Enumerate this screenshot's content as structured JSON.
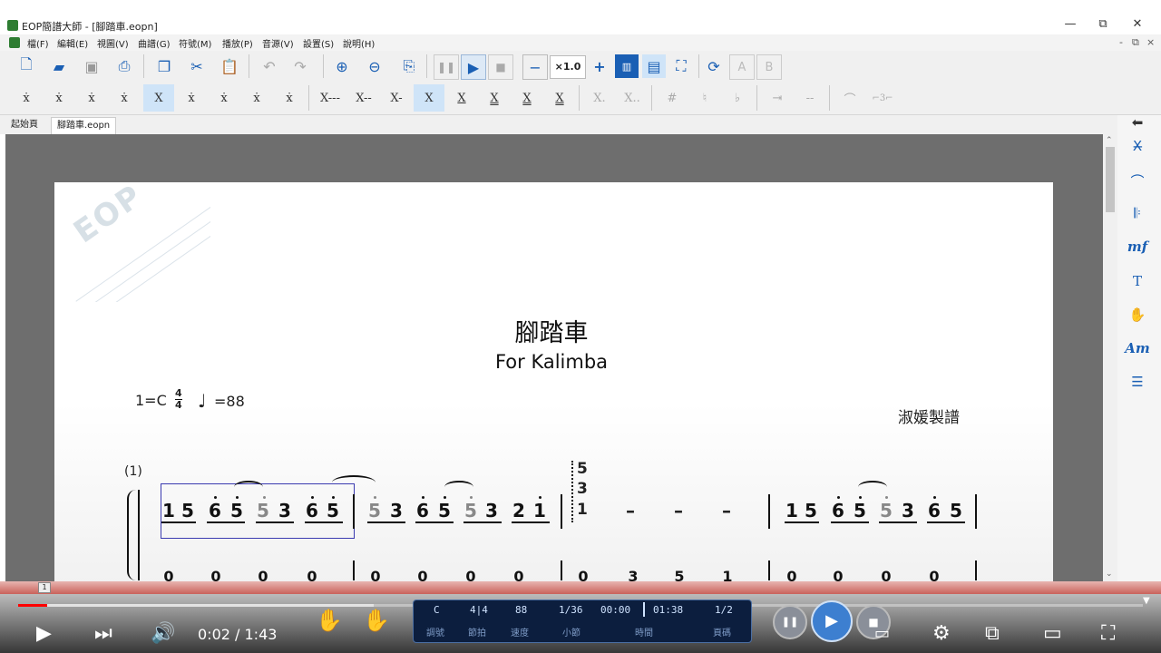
{
  "window": {
    "title": "EOP簡譜大師 - [腳踏車.eopn]",
    "controls": [
      "—",
      "⧉",
      "✕"
    ]
  },
  "menubar": {
    "items": [
      "檔(F)",
      "編輯(E)",
      "視圖(V)",
      "曲譜(G)",
      "符號(M)",
      "播放(P)",
      "音源(V)",
      "設置(S)",
      "說明(H)"
    ],
    "mdi_controls": [
      "-",
      "⧉",
      "×"
    ]
  },
  "toolbar": {
    "speed": "×1.0",
    "playback_icons": [
      "pause-icon",
      "play-icon",
      "stop-icon"
    ],
    "letters": [
      "A",
      "B"
    ]
  },
  "note_toolbar": {
    "duration_labels": [
      "X---",
      "X--",
      "X-",
      "X",
      "X",
      "X",
      "X",
      "X",
      "X.",
      "X.."
    ],
    "accidentals": [
      "#",
      "♮",
      "♭"
    ]
  },
  "tabs": [
    {
      "label": "起始頁",
      "active": false
    },
    {
      "label": "腳踏車.eopn",
      "active": true
    }
  ],
  "right_panel": {
    "tools": [
      "⬅",
      "X̶",
      "⌒",
      "𝄆",
      "mf",
      "T",
      "✋",
      "Am",
      "☰"
    ]
  },
  "score": {
    "watermark": "EOP",
    "title": "腳踏車",
    "subtitle": "For Kalimba",
    "key": "1=C",
    "time_sig_top": "4",
    "time_sig_bottom": "4",
    "tempo_note": "♩",
    "tempo": "=88",
    "credit": "淑媛製譜",
    "measure_number": "(1)",
    "measure1": [
      "1",
      "5",
      "6",
      "5",
      "5",
      "3",
      "6",
      "5"
    ],
    "measure2": [
      "5",
      "3",
      "6",
      "5",
      "5",
      "3",
      "2",
      "1"
    ],
    "measure3_chord": [
      "5",
      "3",
      "1"
    ],
    "measure3_dashes": [
      "–",
      "–",
      "–"
    ],
    "measure4": [
      "1",
      "5",
      "6",
      "5",
      "5",
      "3",
      "6",
      "5"
    ],
    "bass_row": [
      "0",
      "0",
      "0",
      "0",
      "0",
      "0",
      "0",
      "0",
      "0",
      "3",
      "5",
      "1",
      "0",
      "0",
      "0",
      "0"
    ]
  },
  "video": {
    "time": "0:02 / 1:43",
    "progress": 0.02,
    "timeline_marker": "1"
  },
  "status": {
    "values": [
      "C",
      "4|4",
      "88",
      "1/36",
      "00:00",
      "01:38",
      "1/2"
    ],
    "labels": [
      "調號",
      "節拍",
      "速度",
      "小節",
      "時間",
      "",
      "頁碼"
    ]
  }
}
